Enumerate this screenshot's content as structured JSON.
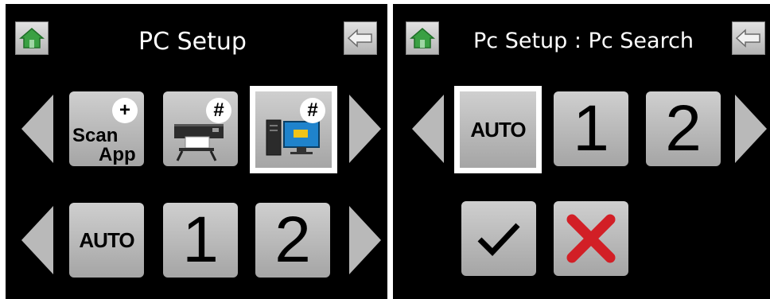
{
  "left_screen": {
    "title": "PC Setup",
    "tiles": {
      "scan_app_line1": "Scan",
      "scan_app_line2": "App",
      "scan_app_badge": "+",
      "printer_badge": "#",
      "pc_badge": "#",
      "auto": "AUTO",
      "one": "1",
      "two": "2"
    },
    "icons": [
      "home-icon",
      "back-icon",
      "arrow-left-icon",
      "arrow-right-icon",
      "printer-icon",
      "computer-icon"
    ]
  },
  "right_screen": {
    "title": "Pc Setup : Pc Search",
    "tiles": {
      "auto": "AUTO",
      "one": "1",
      "two": "2"
    },
    "icons": [
      "home-icon",
      "back-icon",
      "arrow-left-icon",
      "arrow-right-icon",
      "check-icon",
      "cancel-x-icon"
    ]
  },
  "colors": {
    "background": "#000000",
    "tile": "#b9b9b9",
    "selection": "#ffffff",
    "home_green": "#3aa043",
    "cancel_red": "#d21f26"
  }
}
